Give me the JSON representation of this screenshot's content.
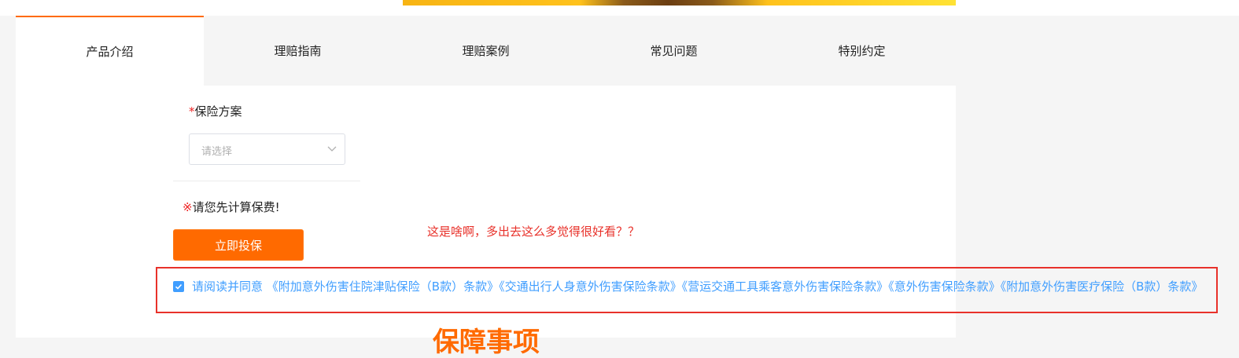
{
  "tabs": [
    {
      "label": "产品介绍"
    },
    {
      "label": "理赔指南"
    },
    {
      "label": "理赔案例"
    },
    {
      "label": "常见问题"
    },
    {
      "label": "特别约定"
    }
  ],
  "form": {
    "required_mark": "*",
    "plan_label": "保险方案",
    "plan_placeholder": "请选择",
    "notice_mark": "※",
    "notice_text": "请您先计算保费!",
    "buy_button": "立即投保"
  },
  "agreement": {
    "checked": true,
    "prefix": "请阅读并同意",
    "documents": [
      "《附加意外伤害住院津贴保险（B款）条款》",
      "《交通出行人身意外伤害保险条款》",
      "《营运交通工具乘客意外伤害保险条款》",
      "《意外伤害保险条款》",
      "《附加意外伤害医疗保险（B款）条款》"
    ]
  },
  "annotation": {
    "comment": "这是啥啊，多出去这么多觉得很好看？？"
  },
  "section": {
    "title": "保障事项"
  },
  "colors": {
    "accent": "#ff6a00",
    "link": "#409eff",
    "annotation": "#e8312a"
  }
}
